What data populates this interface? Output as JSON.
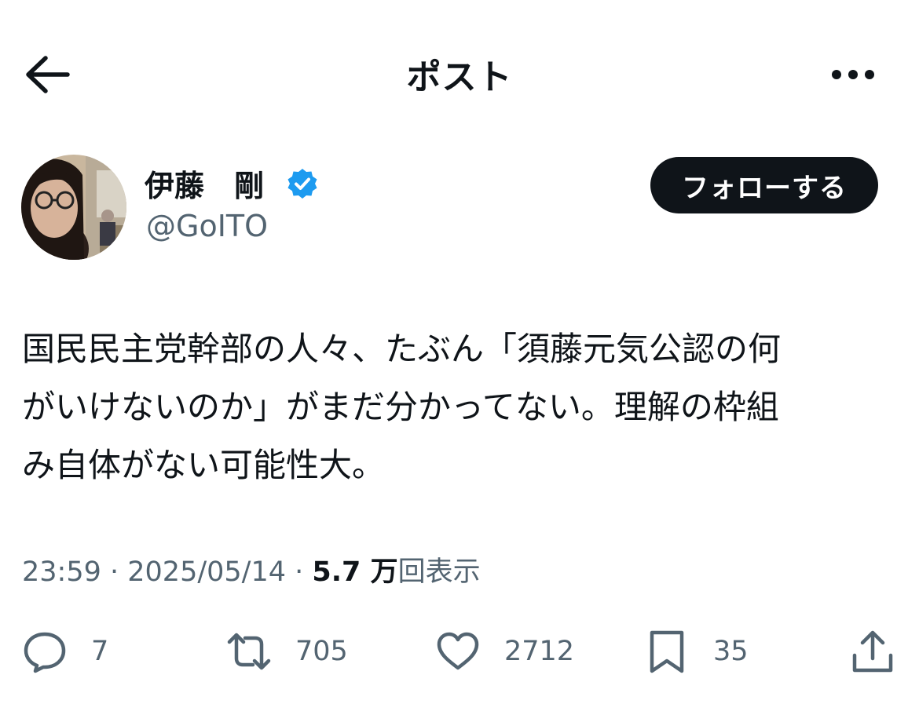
{
  "header": {
    "title": "ポスト"
  },
  "author": {
    "display_name": "伊藤　剛",
    "handle": "@GoITO",
    "verified": true
  },
  "follow_button": {
    "label": "フォローする"
  },
  "tweet": {
    "lines": [
      "国民民主党幹部の人々、たぶん「須藤元気公認の何",
      "がいけないのか」がまだ分かってない。理解の枠組",
      "み自体がない可能性大。"
    ]
  },
  "meta": {
    "time": "23:59",
    "separator": " · ",
    "date": "2025/05/14",
    "views_number": "5.7 万",
    "views_label": "回表示"
  },
  "actions": {
    "reply": {
      "icon": "reply-icon",
      "count": "7"
    },
    "repost": {
      "icon": "repost-icon",
      "count": "705"
    },
    "like": {
      "icon": "heart-icon",
      "count": "2712"
    },
    "bookmark": {
      "icon": "bookmark-icon",
      "count": "35"
    },
    "share": {
      "icon": "share-icon"
    }
  },
  "colors": {
    "text_primary": "#0f1419",
    "text_secondary": "#536471",
    "verified_blue": "#1d9bf0",
    "follow_bg": "#0f1419"
  }
}
